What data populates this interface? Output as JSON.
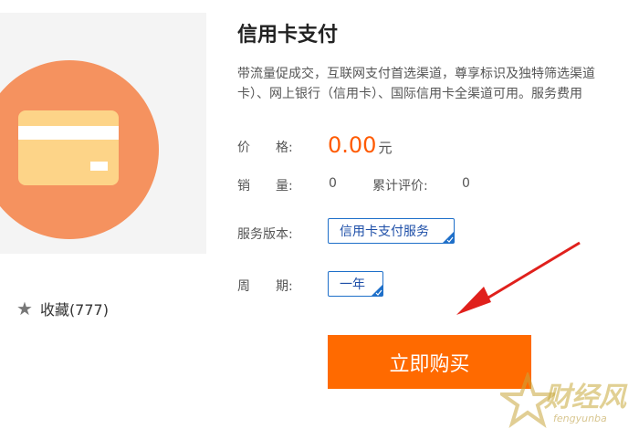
{
  "product": {
    "title": "信用卡支付",
    "description_line1": "带流量促成交，互联网支付首选渠道，尊享标识及独特筛选渠道",
    "description_line2": "卡）、网上银行（信用卡）、国际信用卡全渠道可用。服务费用"
  },
  "price": {
    "label": "价　　格:",
    "value": "0.00",
    "unit": "元"
  },
  "stats": {
    "sales_label": "销　　量:",
    "sales_value": "0",
    "reviews_label": "累计评价:",
    "reviews_value": "0"
  },
  "options": {
    "version_label": "服务版本:",
    "version_selected": "信用卡支付服务",
    "period_label": "周　　期:",
    "period_selected": "一年"
  },
  "favorite": {
    "icon": "star-icon",
    "label": "收藏(777)"
  },
  "buy_button": {
    "label": "立即购买"
  },
  "watermark": {
    "text": "财经风",
    "sub": "fengyunba"
  },
  "colors": {
    "accent": "#ff6a00",
    "price": "#ff5a00",
    "option_border": "#1e6fc9",
    "arrow": "#e0201c",
    "icon_circle": "#f5925f",
    "card": "#fdd488"
  }
}
